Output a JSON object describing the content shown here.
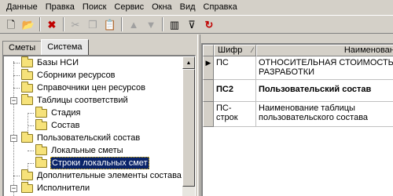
{
  "menu": [
    "Данные",
    "Правка",
    "Поиск",
    "Сервис",
    "Окна",
    "Вид",
    "Справка"
  ],
  "toolbar": {
    "icons": [
      "new-document-icon",
      "open-folder-icon",
      "delete-icon",
      "cut-icon",
      "copy-icon",
      "paste-icon",
      "move-up-icon",
      "move-down-icon",
      "columns-icon",
      "filter-icon",
      "refresh-icon"
    ],
    "glyphs": {
      "new": "🗋",
      "open": "📂",
      "delete": "✖",
      "cut": "✂",
      "copy": "❐",
      "paste": "📋",
      "up": "▲",
      "down": "▼",
      "columns": "▥",
      "filter": "⊽",
      "refresh": "↻"
    }
  },
  "tabs": [
    "Сметы",
    "Система"
  ],
  "active_tab": "Система",
  "tree": [
    {
      "label": "Базы НСИ",
      "level": 1,
      "expanded": null,
      "selected": false
    },
    {
      "label": "Сборники ресурсов",
      "level": 1,
      "expanded": null,
      "selected": false
    },
    {
      "label": "Справочники цен ресурсов",
      "level": 1,
      "expanded": null,
      "selected": false
    },
    {
      "label": "Таблицы соответствий",
      "level": 1,
      "expanded": true,
      "selected": false
    },
    {
      "label": "Стадия",
      "level": 2,
      "expanded": null,
      "selected": false
    },
    {
      "label": "Состав",
      "level": 2,
      "expanded": null,
      "selected": false
    },
    {
      "label": "Пользовательский состав",
      "level": 1,
      "expanded": true,
      "selected": false
    },
    {
      "label": "Локальные сметы",
      "level": 2,
      "expanded": null,
      "selected": false
    },
    {
      "label": "Строки локальных смет",
      "level": 2,
      "expanded": null,
      "selected": true
    },
    {
      "label": "Дополнительные элементы состава",
      "level": 1,
      "expanded": null,
      "selected": false
    },
    {
      "label": "Исполнители",
      "level": 1,
      "expanded": true,
      "selected": false
    }
  ],
  "grid": {
    "columns": {
      "code": "Шифр",
      "name": "Наименование"
    },
    "rows": [
      {
        "code": "ПС",
        "name": "ОТНОСИТЕЛЬНАЯ СТОИМОСТЬ\nРАЗРАБОТКИ",
        "bold": false,
        "current": true
      },
      {
        "code": "ПС2",
        "name": "Пользовательский состав",
        "bold": true,
        "current": false
      },
      {
        "code": "ПС-строк",
        "name": "Наименование таблицы\nпользовательского состава",
        "bold": false,
        "current": false
      }
    ]
  }
}
